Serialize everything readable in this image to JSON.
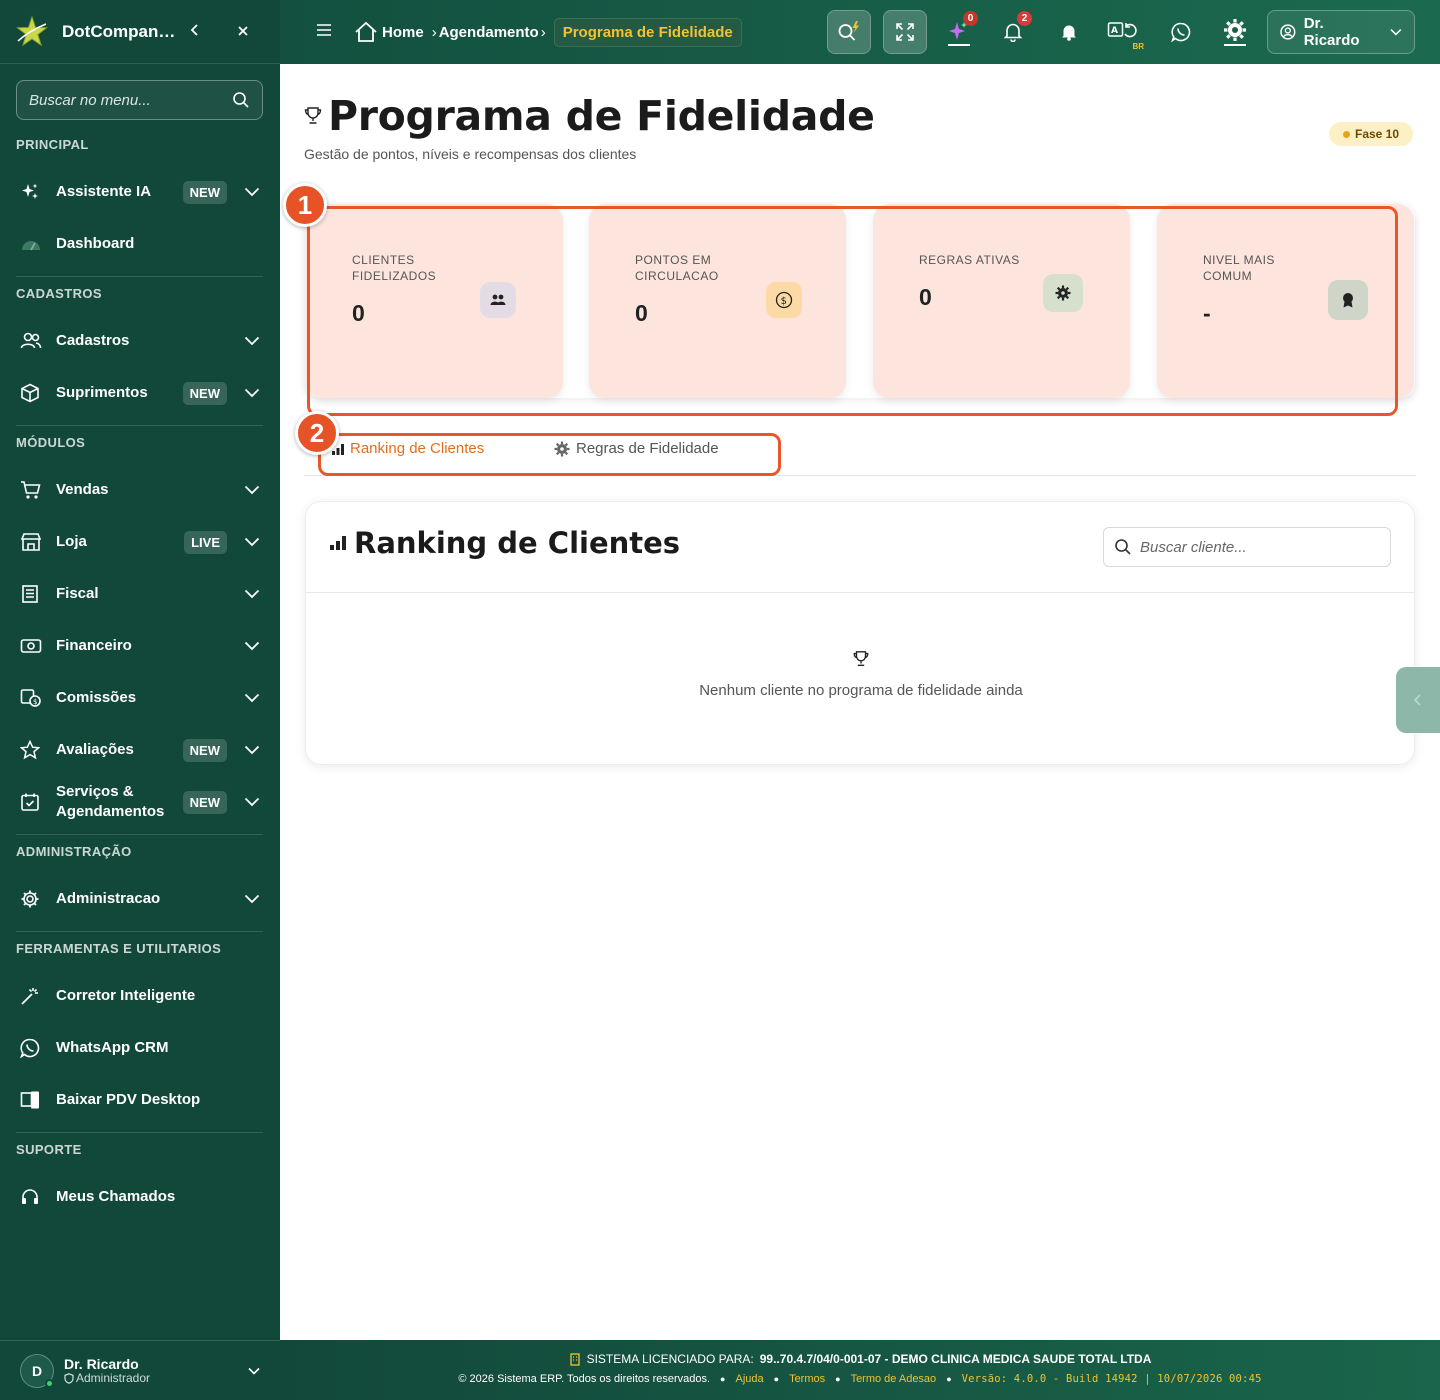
{
  "app": {
    "brand": "DotCompanion",
    "collapse_icon": "chevron-left-icon",
    "close_label": "✕"
  },
  "sidebar": {
    "search_placeholder": "Buscar no menu...",
    "sections": {
      "principal": "PRINCIPAL",
      "cadastros": "CADASTROS",
      "modulos": "MÓDULOS",
      "administracao": "ADMINISTRAÇÃO",
      "ferramentas": "FERRAMENTAS E UTILITARIOS",
      "suporte": "SUPORTE"
    },
    "items": {
      "assistente": {
        "label": "Assistente IA",
        "badge": "NEW"
      },
      "dashboard": {
        "label": "Dashboard"
      },
      "cadastros": {
        "label": "Cadastros"
      },
      "suprimentos": {
        "label": "Suprimentos",
        "badge": "NEW"
      },
      "vendas": {
        "label": "Vendas"
      },
      "loja": {
        "label": "Loja",
        "badge": "LIVE"
      },
      "fiscal": {
        "label": "Fiscal"
      },
      "financeiro": {
        "label": "Financeiro"
      },
      "comissoes": {
        "label": "Comissões"
      },
      "avaliacoes": {
        "label": "Avaliações",
        "badge": "NEW"
      },
      "servicos": {
        "label": "Serviços & Agendamentos",
        "badge": "NEW"
      },
      "administracao": {
        "label": "Administracao"
      },
      "corretor": {
        "label": "Corretor Inteligente"
      },
      "whatsapp": {
        "label": "WhatsApp CRM"
      },
      "pdv": {
        "label": "Baixar PDV Desktop"
      },
      "chamados": {
        "label": "Meus Chamados"
      }
    },
    "user": {
      "initial": "D",
      "name": "Dr. Ricardo",
      "role": "Administrador"
    }
  },
  "topbar": {
    "breadcrumb": {
      "home": "Home",
      "agendamento": "Agendamento",
      "current": "Programa de Fidelidade"
    },
    "ai_count": "0",
    "notif_count": "2",
    "lang_badge": "BR",
    "user_label": "Dr. Ricardo"
  },
  "page": {
    "title": "Programa de Fidelidade",
    "subtitle": "Gestão de pontos, níveis e recompensas dos clientes",
    "phase": "Fase 10"
  },
  "stats": [
    {
      "label": "CLIENTES FIDELIZADOS",
      "value": "0",
      "icon": "users-icon",
      "icon_bg": "#e4dce4"
    },
    {
      "label": "PONTOS EM CIRCULACAO",
      "value": "0",
      "icon": "coin-icon",
      "icon_bg": "#fdd9a6"
    },
    {
      "label": "REGRAS ATIVAS",
      "value": "0",
      "icon": "gear-icon",
      "icon_bg": "#d6e0cd"
    },
    {
      "label": "NIVEL MAIS COMUM",
      "value": "-",
      "icon": "award-icon",
      "icon_bg": "#cfd6c9"
    }
  ],
  "annotations": {
    "one": "1",
    "two": "2"
  },
  "tabs": {
    "ranking": "Ranking de Clientes",
    "regras": "Regras de Fidelidade"
  },
  "ranking": {
    "title": "Ranking de Clientes",
    "search_placeholder": "Buscar cliente...",
    "empty": "Nenhum cliente no programa de fidelidade ainda"
  },
  "footer": {
    "license_prefix": "SISTEMA LICENCIADO PARA:",
    "license_value": "99..70.4.7/04/0-001-07 - DEMO CLINICA MEDICA SAUDE TOTAL LTDA",
    "copyright": "© 2026 Sistema ERP. Todos os direitos reservados.",
    "links": {
      "ajuda": "Ajuda",
      "termos": "Termos",
      "adesao": "Termo de Adesao"
    },
    "version": "Versão: 4.0.0 - Build 14942 | 10/07/2026 00:45"
  },
  "colors": {
    "sidebar": "#12483a",
    "accent": "#e0701c",
    "annotation": "#e8572a",
    "stat_card": "#fde5de",
    "highlight": "#f1c232"
  }
}
